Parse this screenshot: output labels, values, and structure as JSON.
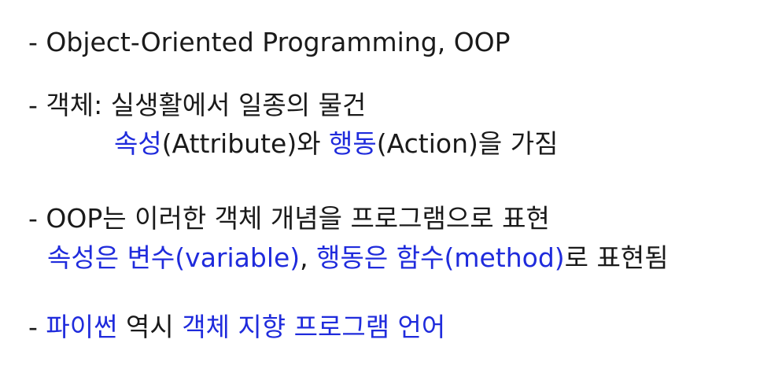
{
  "lines": [
    {
      "segments": [
        {
          "text": "- Object-Oriented Programming, OOP",
          "color": "#1a1a1a"
        }
      ]
    },
    {
      "segments": [
        {
          "text": "- 객체: 실생활에서 일종의 물건",
          "color": "#1a1a1a"
        }
      ]
    },
    {
      "segments": [
        {
          "text": "속성",
          "color": "#1f2bdc"
        },
        {
          "text": "(Attribute)와 ",
          "color": "#1a1a1a"
        },
        {
          "text": "행동",
          "color": "#1f2bdc"
        },
        {
          "text": "(Action)을 가짐",
          "color": "#1a1a1a"
        }
      ]
    },
    {
      "segments": [
        {
          "text": "- OOP는 이러한 객체 개념을 프로그램으로 표현",
          "color": "#1a1a1a"
        }
      ]
    },
    {
      "segments": [
        {
          "text": "속성은 변수(variable)",
          "color": "#1f2bdc"
        },
        {
          "text": ", ",
          "color": "#1a1a1a"
        },
        {
          "text": "행동은 함수(method)",
          "color": "#1f2bdc"
        },
        {
          "text": "로 표현됨",
          "color": "#1a1a1a"
        }
      ]
    },
    {
      "segments": [
        {
          "text": "- ",
          "color": "#1a1a1a"
        },
        {
          "text": "파이썬",
          "color": "#1f2bdc"
        },
        {
          "text": " 역시 ",
          "color": "#1a1a1a"
        },
        {
          "text": "객체 지향 프로그램 언어",
          "color": "#1f2bdc"
        }
      ]
    }
  ]
}
